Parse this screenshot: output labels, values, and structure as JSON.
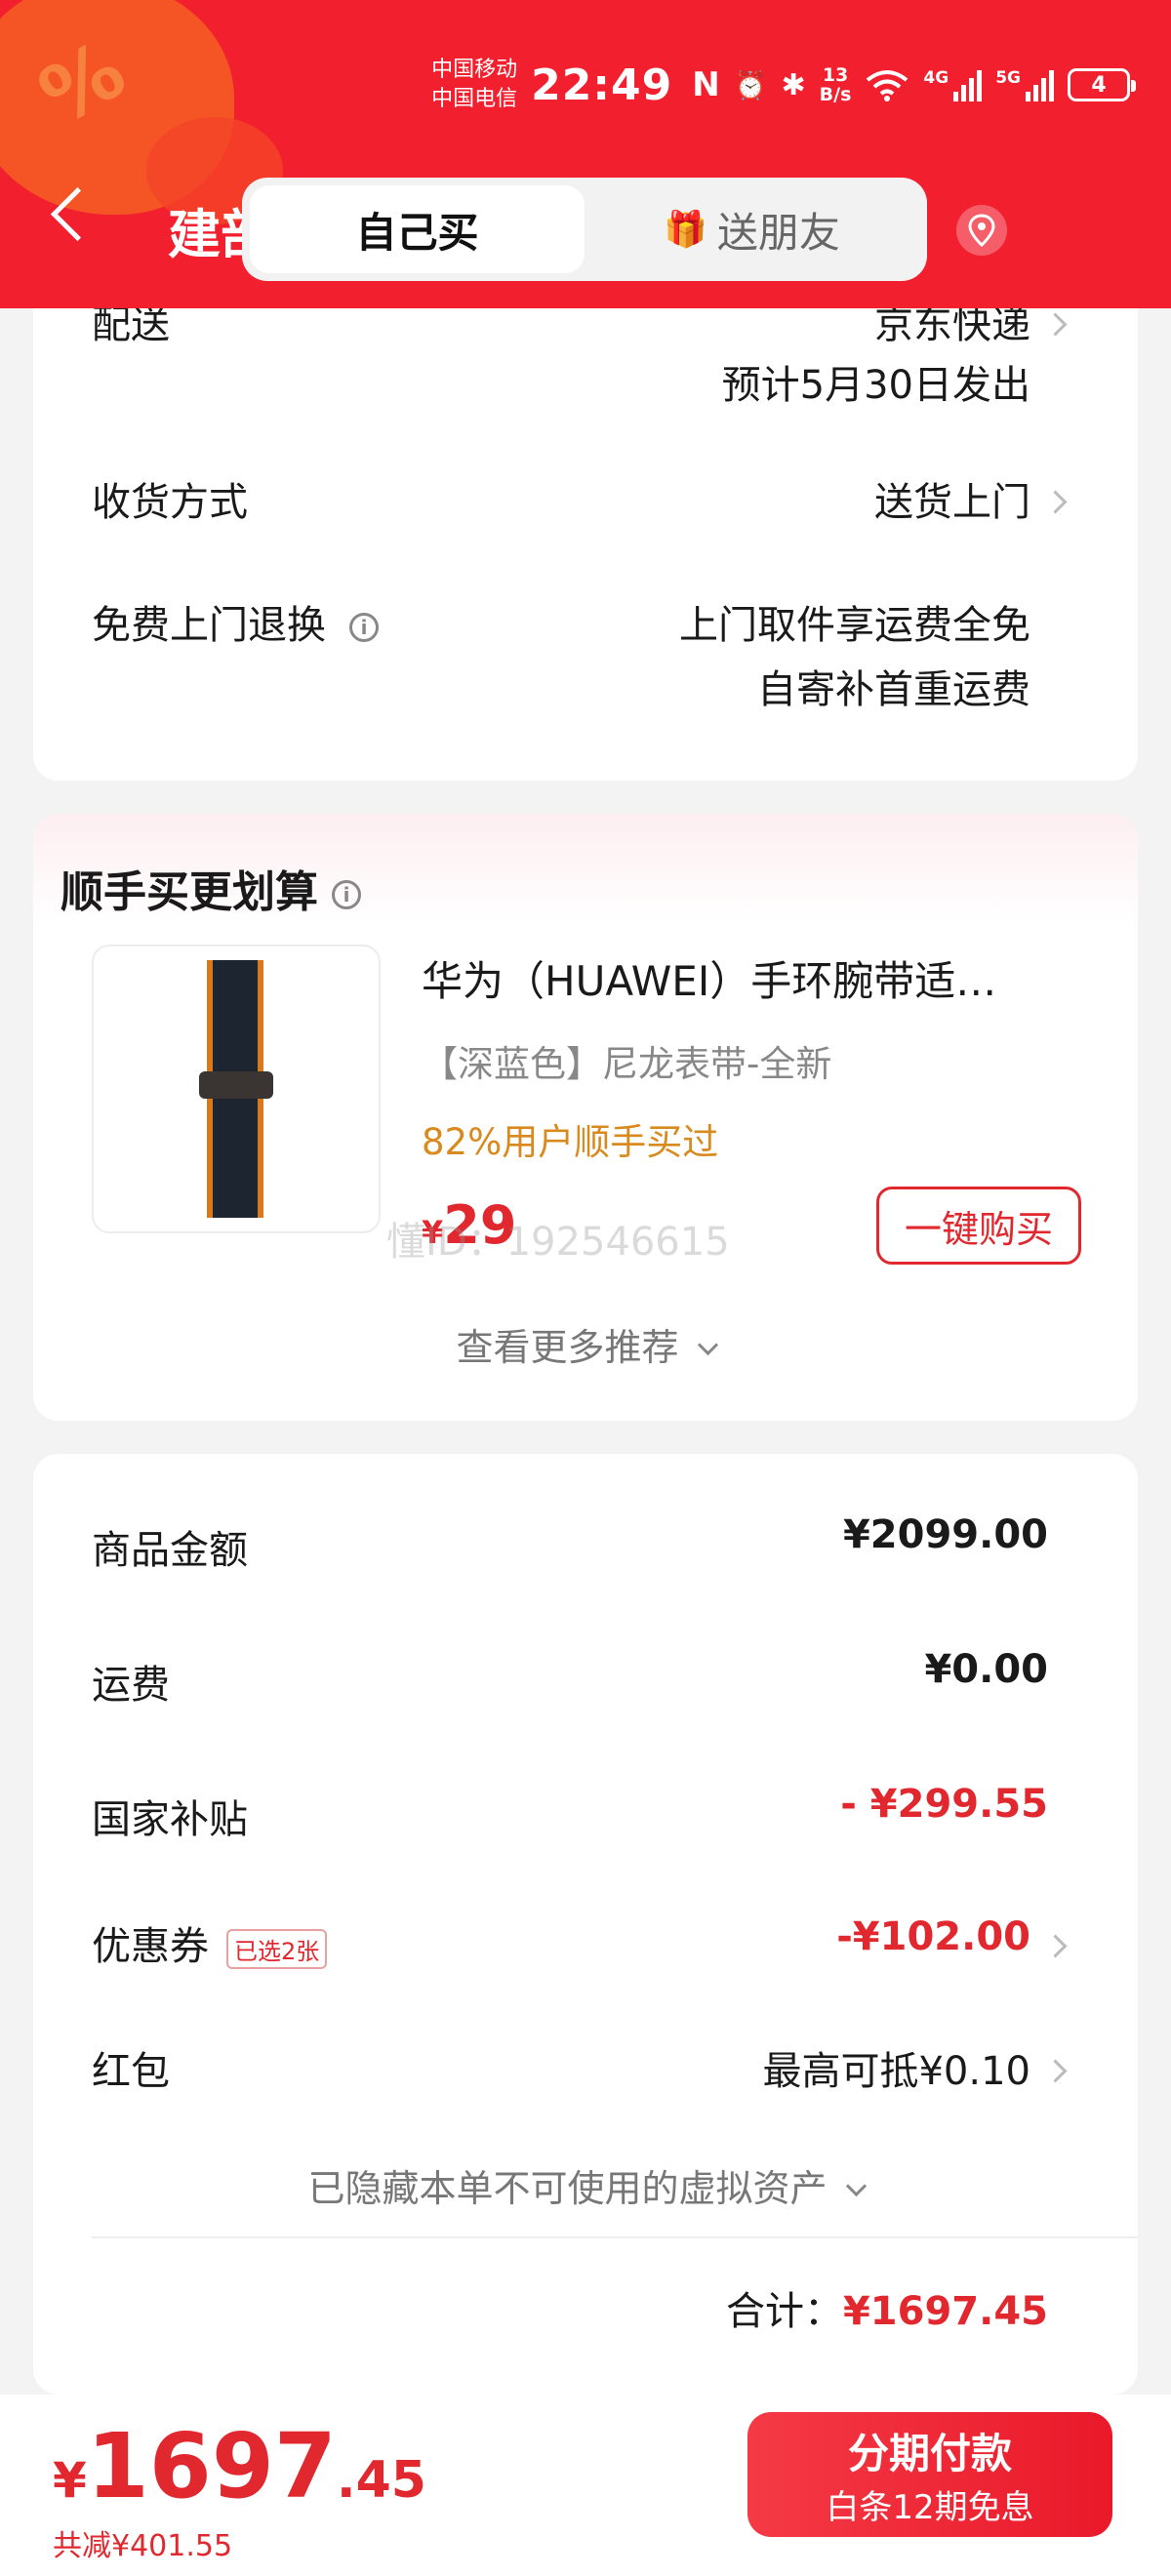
{
  "status_bar": {
    "carrier1": "中国移动",
    "carrier2": "中国电信",
    "time": "22:49",
    "nfc": "N",
    "alarm": "⏰",
    "bluetooth": "✱",
    "net_speed_value": "13",
    "net_speed_unit": "B/s",
    "sig1_label": "4G",
    "sig2_label": "5G",
    "battery": "4"
  },
  "header": {
    "title_partial": "建部",
    "tabs": [
      "自己买",
      "送朋友"
    ],
    "gift_icon": "🎁"
  },
  "delivery": {
    "label": "配送",
    "value": "京东快递",
    "estimate": "预计5月30日发出",
    "receive_label": "收货方式",
    "receive_value": "送货上门",
    "return_label": "免费上门退换",
    "return_value1": "上门取件享运费全免",
    "return_value2": "自寄补首重运费"
  },
  "recommend": {
    "title": "顺手买更划算",
    "product_name": "华为（HUAWEI）手环腕带适…",
    "product_spec": "【深蓝色】尼龙表带-全新",
    "stat": "82%用户顺手买过",
    "currency": "¥",
    "price": "29",
    "buy_button": "一键购买",
    "more": "查看更多推荐",
    "watermark": "懂ID：192546615"
  },
  "summary": {
    "goods_label": "商品金额",
    "goods_value": "¥2099.00",
    "ship_label": "运费",
    "ship_value": "¥0.00",
    "subsidy_label": "国家补贴",
    "subsidy_value": "- ¥299.55",
    "coupon_label": "优惠券",
    "coupon_badge": "已选2张",
    "coupon_value": "-¥102.00",
    "redpack_label": "红包",
    "redpack_value": "最高可抵¥0.10",
    "hidden_assets": "已隐藏本单不可使用的虚拟资产",
    "total_label": "合计：",
    "total_value": "¥1697.45"
  },
  "bottom": {
    "currency": "¥",
    "price_int": "1697",
    "price_dec": ".45",
    "saved": "共减¥401.55",
    "pay_title": "分期付款",
    "pay_sub": "白条12期免息"
  },
  "colors": {
    "brand_red": "#f2202e",
    "price_red": "#e0282e",
    "stat_orange": "#d98a1e"
  }
}
